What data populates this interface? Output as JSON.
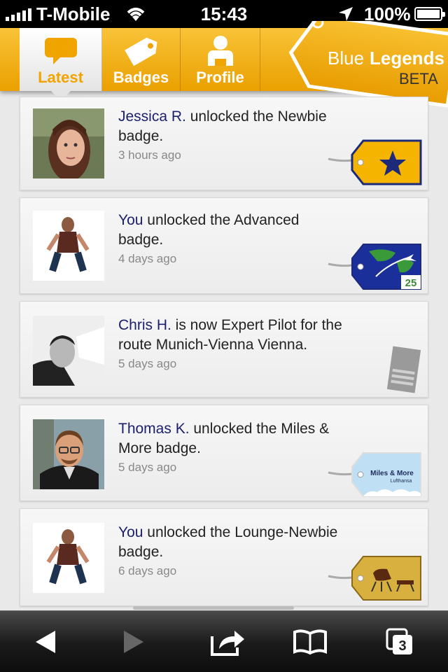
{
  "status_bar": {
    "carrier": "T-Mobile",
    "time": "15:43",
    "battery": "100%",
    "signal_icon": "signal-bars-icon",
    "wifi_icon": "wifi-icon",
    "location_icon": "location-arrow-icon"
  },
  "tabs": [
    {
      "label": "Latest",
      "icon": "speech-bubble-icon",
      "active": true
    },
    {
      "label": "Badges",
      "icon": "tag-icon",
      "active": false
    },
    {
      "label": "Profile",
      "icon": "person-icon",
      "active": false
    }
  ],
  "logo": {
    "blue": "Blue",
    "legends": "Legends",
    "beta": "BETA"
  },
  "feed": [
    {
      "who": "Jessica R.",
      "text": " unlocked the Newbie badge.",
      "time": "3 hours ago",
      "badge": "newbie-star-badge"
    },
    {
      "who": "You",
      "text": " unlocked the Advanced badge.",
      "time": "4 days ago",
      "badge": "advanced-globe-badge",
      "badge_number": "25"
    },
    {
      "who": "Chris H.",
      "text": " is now Expert Pilot for the route Munich-Vienna Vienna.",
      "time": "5 days ago",
      "badge": "expert-pilot-badge"
    },
    {
      "who": "Thomas K.",
      "text": " unlocked the Miles & More badge.",
      "time": "5 days ago",
      "badge": "miles-and-more-badge",
      "badge_title": "Miles & More",
      "badge_sub": "Lufthansa"
    },
    {
      "who": "You",
      "text": " unlocked the Lounge-Newbie badge.",
      "time": "6 days ago",
      "badge": "lounge-chair-badge"
    }
  ],
  "toolbar": {
    "back": "back-arrow-icon",
    "forward": "forward-arrow-icon",
    "share": "share-icon",
    "bookmarks": "open-book-icon",
    "tabs": "tabs-icon",
    "tab_count": "3"
  },
  "colors": {
    "header_orange": "#f0a800",
    "name_blue": "#1a1f6e",
    "timestamp_gray": "#888888"
  }
}
